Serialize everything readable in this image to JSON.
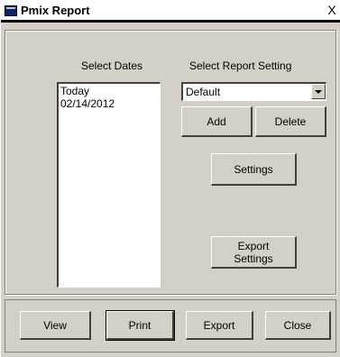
{
  "window": {
    "title": "Pmix Report",
    "close_glyph": "X"
  },
  "dates": {
    "label": "Select Dates",
    "items": [
      "Today",
      "02/14/2012"
    ]
  },
  "report_setting": {
    "label": "Select Report Setting",
    "value": "Default",
    "add_label": "Add",
    "delete_label": "Delete",
    "settings_label": "Settings",
    "export_settings_line1": "Export",
    "export_settings_line2": "Settings"
  },
  "footer": {
    "view_label": "View",
    "print_label": "Print",
    "export_label": "Export",
    "close_label": "Close"
  }
}
